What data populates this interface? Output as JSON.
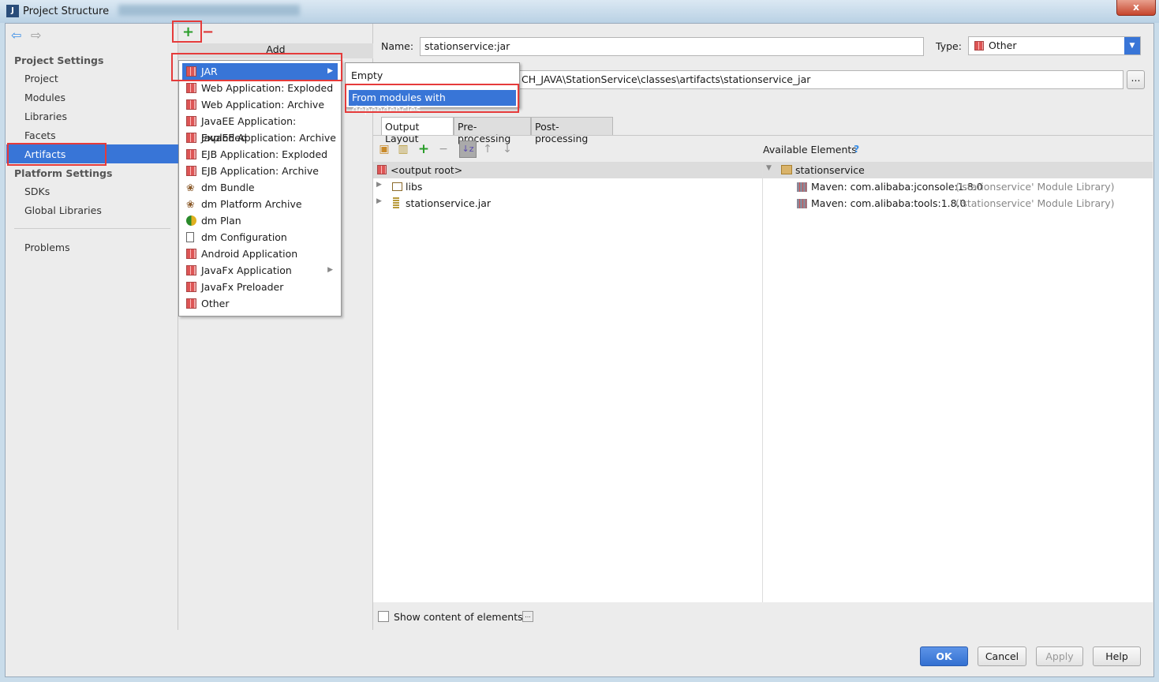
{
  "window": {
    "title": "Project Structure",
    "close": "x"
  },
  "sidebar": {
    "nav": {
      "back": "⇦",
      "forward": "⇨"
    },
    "project_settings": "Project Settings",
    "items": [
      "Project",
      "Modules",
      "Libraries",
      "Facets",
      "Artifacts"
    ],
    "platform_settings": "Platform Settings",
    "platform_items": [
      "SDKs",
      "Global Libraries"
    ],
    "problems": "Problems",
    "selected": "Artifacts"
  },
  "artifacts_panel": {
    "add": "+",
    "remove": "−",
    "add_header": "Add"
  },
  "add_menu": {
    "items": [
      {
        "label": "JAR",
        "icon": "jar-icon",
        "submenu": true
      },
      {
        "label": "Web Application: Exploded",
        "icon": "web-icon"
      },
      {
        "label": "Web Application: Archive",
        "icon": "web-icon"
      },
      {
        "label": "JavaEE Application: Exploded",
        "icon": "javaee-icon"
      },
      {
        "label": "JavaEE Application: Archive",
        "icon": "javaee-icon"
      },
      {
        "label": "EJB Application: Exploded",
        "icon": "ejb-icon"
      },
      {
        "label": "EJB Application: Archive",
        "icon": "ejb-icon"
      },
      {
        "label": "dm Bundle",
        "icon": "bundle-icon"
      },
      {
        "label": "dm Platform Archive",
        "icon": "bundle-icon"
      },
      {
        "label": "dm Plan",
        "icon": "plan-icon"
      },
      {
        "label": "dm Configuration",
        "icon": "document-icon"
      },
      {
        "label": "Android Application",
        "icon": "android-icon"
      },
      {
        "label": "JavaFx Application",
        "icon": "javafx-icon",
        "submenu": true
      },
      {
        "label": "JavaFx Preloader",
        "icon": "javafx-icon"
      },
      {
        "label": "Other",
        "icon": "other-icon"
      }
    ]
  },
  "jar_submenu": {
    "items": [
      "Empty",
      "From modules with dependencies..."
    ]
  },
  "details": {
    "name_label": "Name:",
    "name_value": "stationservice:jar",
    "type_label": "Type:",
    "type_value": "Other",
    "output_dir": "CH_JAVA\\StationService\\classes\\artifacts\\stationservice_jar",
    "browse": "...",
    "tabs": [
      "Output Layout",
      "Pre-processing",
      "Post-processing"
    ],
    "available_elements": "Available Elements",
    "help": "?",
    "output_tree": [
      "<output root>",
      "libs",
      "stationservice.jar"
    ],
    "available_tree": {
      "root": "stationservice",
      "children": [
        {
          "label": "Maven: com.alibaba:jconsole:1.8.0",
          "note": "('stationservice' Module Library)"
        },
        {
          "label": "Maven: com.alibaba:tools:1.8.0",
          "note": "('stationservice' Module Library)"
        }
      ]
    },
    "show_content": "Show content of elements",
    "show_content_checked": false
  },
  "buttons": {
    "ok": "OK",
    "cancel": "Cancel",
    "apply": "Apply",
    "help": "Help"
  },
  "colors": {
    "selection": "#3875d7",
    "highlight_box": "#e53b3b"
  }
}
